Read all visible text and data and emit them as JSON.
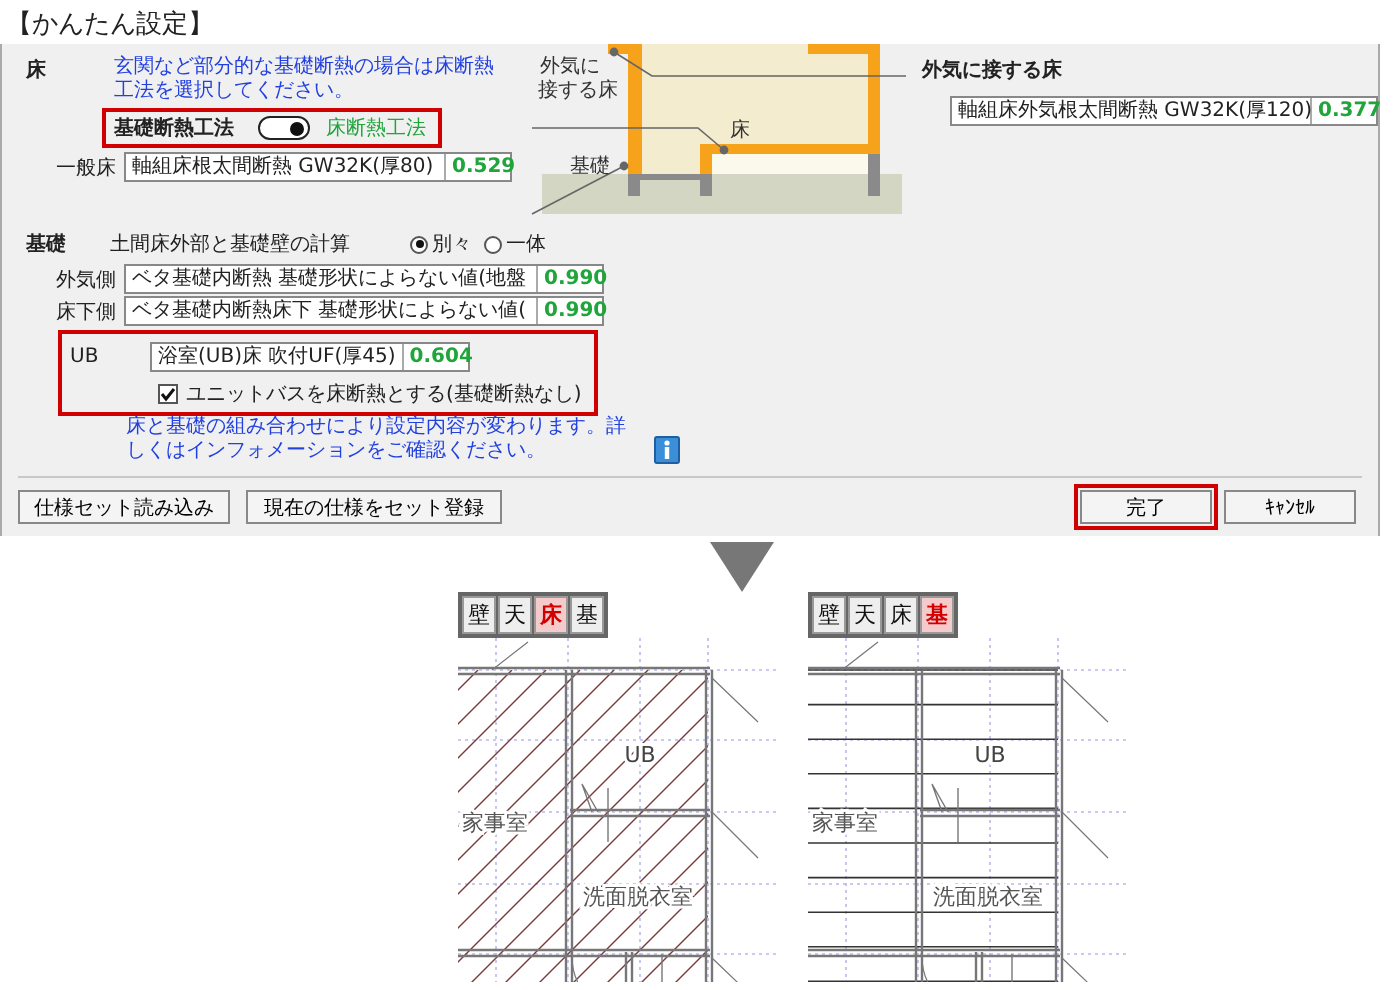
{
  "title": "【かんたん設定】",
  "floor": {
    "heading": "床",
    "note": "玄関など部分的な基礎断熱の場合は床断熱工法を選択してください。",
    "method": {
      "label": "基礎断熱工法",
      "on": true,
      "value": "床断熱工法",
      "highlighted": true
    },
    "general": {
      "label": "一般床",
      "spec": "軸組床根太間断熱 GW32K(厚80)",
      "value": "0.529"
    }
  },
  "diagram": {
    "exterior_label": [
      "外気に",
      "接する床"
    ],
    "floor_label": "床",
    "foundation_label": "基礎"
  },
  "exterior_floor": {
    "heading": "外気に接する床",
    "spec": "軸組床外気根太間断熱 GW32K(厚120)",
    "value": "0.377"
  },
  "foundation": {
    "heading": "基礎",
    "calc_label": "土間床外部と基礎壁の計算",
    "calc_options": [
      {
        "label": "別々",
        "selected": true
      },
      {
        "label": "一体",
        "selected": false
      }
    ],
    "rows": [
      {
        "label": "外気側",
        "spec": "ベタ基礎内断熱 基礎形状によらない値(地盤",
        "value": "0.990"
      },
      {
        "label": "床下側",
        "spec": "ベタ基礎内断熱床下 基礎形状によらない値(",
        "value": "0.990"
      }
    ],
    "ub": {
      "highlighted": true,
      "label": "UB",
      "spec": "浴室(UB)床 吹付UF(厚45)",
      "value": "0.604",
      "checkbox": {
        "label": "ユニットバスを床断熱とする(基礎断熱なし)",
        "checked": true
      }
    },
    "note": "床と基礎の組み合わせにより設定内容が変わります。詳しくはインフォメーションをご確認ください。"
  },
  "buttons_left": [
    "仕様セット読み込み",
    "現在の仕様をセット登録"
  ],
  "buttons_right": [
    {
      "label": "完了",
      "highlighted": true
    },
    {
      "label": "ｷｬﾝｾﾙ",
      "highlighted": false
    }
  ],
  "plans": [
    {
      "tabs": [
        {
          "label": "壁",
          "selected": false
        },
        {
          "label": "天",
          "selected": false
        },
        {
          "label": "床",
          "selected": true
        },
        {
          "label": "基",
          "selected": false
        }
      ],
      "kind": "diagonal",
      "rooms": [
        "UB",
        "家事室",
        "洗面脱衣室"
      ]
    },
    {
      "tabs": [
        {
          "label": "壁",
          "selected": false
        },
        {
          "label": "天",
          "selected": false
        },
        {
          "label": "床",
          "selected": false
        },
        {
          "label": "基",
          "selected": true
        }
      ],
      "kind": "horizontal",
      "rooms": [
        "UB",
        "家事室",
        "洗面脱衣室"
      ]
    }
  ]
}
